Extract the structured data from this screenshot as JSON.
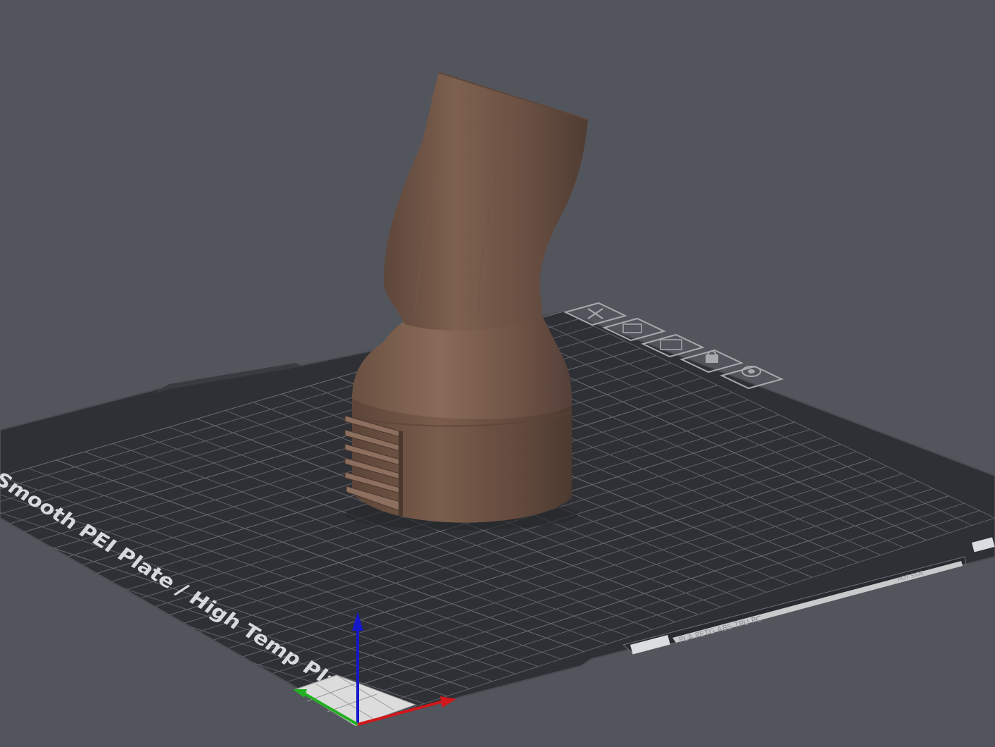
{
  "viewport": {
    "background_color": "#53555c",
    "plate": {
      "label": "Smooth PEI Plate / High Temp Plate",
      "strip_text": "PLA PETG ABS TPU PC",
      "strip_text_small": "HOT SIDE",
      "plate_color": "#2f3035",
      "grid_color": "#60636b",
      "edge_color": "#4a4c53"
    },
    "model": {
      "color": "#6f5547",
      "highlight_color": "#8a6d5d",
      "shadow_color": "#4e3b31"
    },
    "plate_icons": [
      {
        "name": "close-icon"
      },
      {
        "name": "arrange-icon"
      },
      {
        "name": "orient-icon"
      },
      {
        "name": "lock-icon"
      },
      {
        "name": "settings-icon"
      }
    ],
    "axes": {
      "x_color": "#d0171b",
      "y_color": "#22b022",
      "z_color": "#1418c8"
    }
  }
}
